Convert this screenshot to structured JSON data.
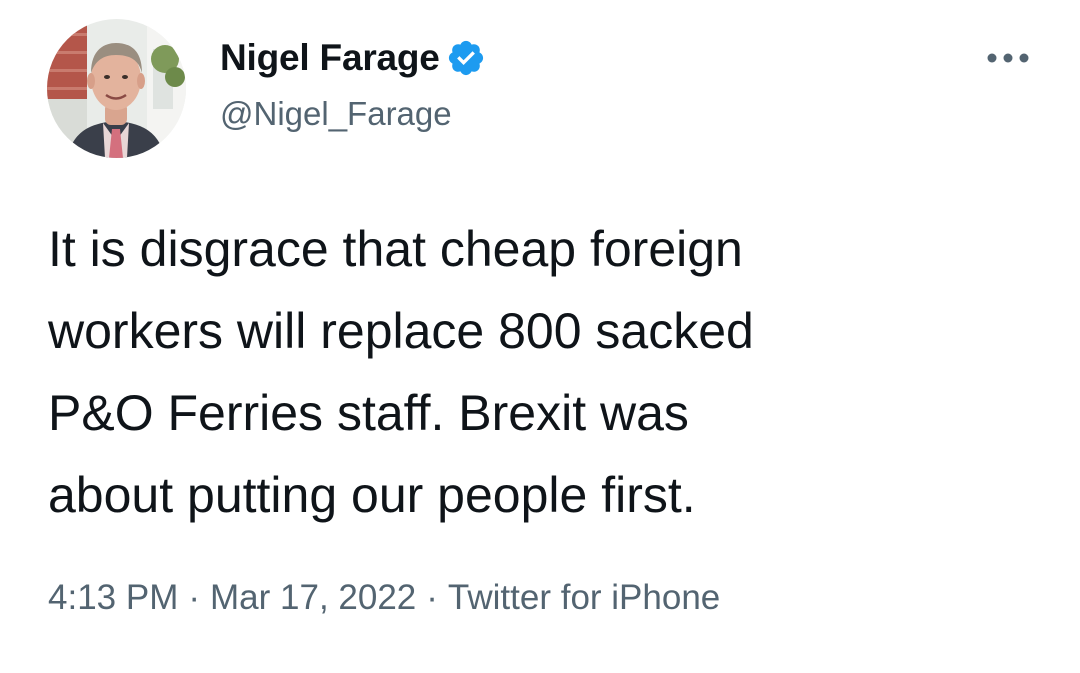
{
  "author": {
    "display_name": "Nigel Farage",
    "handle": "@Nigel_Farage",
    "verified": true
  },
  "icons": {
    "avatar": "profile-photo",
    "verified": "verified-badge-icon",
    "more": "more-options-icon"
  },
  "colors": {
    "text": "#0f1419",
    "secondary": "#536471",
    "verified_blue": "#1d9bf0",
    "background": "#ffffff"
  },
  "tweet": {
    "text": "It is disgrace that cheap foreign\nworkers will replace 800 sacked\nP&O Ferries staff. Brexit was\nabout putting our people first."
  },
  "meta": {
    "time": "4:13 PM",
    "separator": "·",
    "date": "Mar 17, 2022",
    "source": "Twitter for iPhone"
  }
}
